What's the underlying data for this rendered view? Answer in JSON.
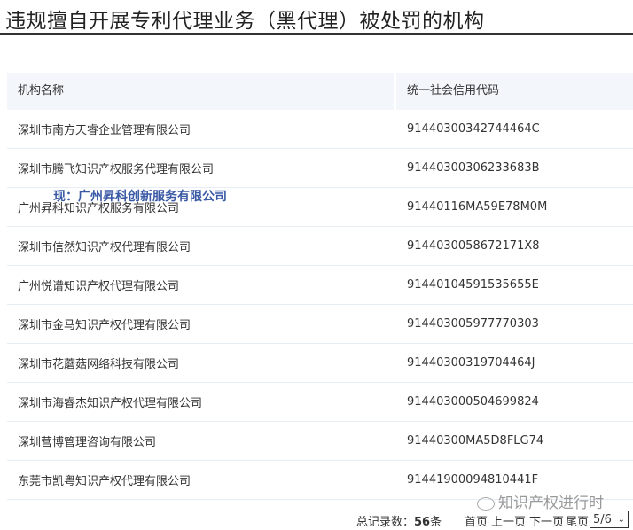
{
  "title": "违规擅自开展专利代理业务（黑代理）被处罚的机构",
  "table": {
    "headers": [
      "机构名称",
      "统一社会信用代码"
    ],
    "rows": [
      {
        "name": "深圳市南方天睿企业管理有限公司",
        "code": "91440300342744464C"
      },
      {
        "name": "深圳市腾飞知识产权服务代理有限公司",
        "code": "91440300306233683B"
      },
      {
        "name": "广州昇科知识产权服务有限公司",
        "code": "91440116MA59E78M0M"
      },
      {
        "name": "深圳市信然知识产权代理有限公司",
        "code": "9144030058672171X8"
      },
      {
        "name": "广州悦谱知识产权代理有限公司",
        "code": "91440104591535655E"
      },
      {
        "name": "深圳市金马知识产权代理有限公司",
        "code": "914403005977770303"
      },
      {
        "name": "深圳市花蘑菇网络科技有限公司",
        "code": "91440300319704464J"
      },
      {
        "name": "深圳市海睿杰知识产权代理有限公司",
        "code": "914403000504699824"
      },
      {
        "name": "深圳营博管理咨询有限公司",
        "code": "91440300MA5D8FLG74"
      },
      {
        "name": "东莞市凯粤知识产权代理有限公司",
        "code": "91441900094810441F"
      }
    ]
  },
  "annotation": "现：广州昇科创新服务有限公司",
  "footer": {
    "total_label": "总记录数：",
    "total_count": "56",
    "total_unit": "条",
    "first": "首页",
    "prev": "上一页",
    "next": "下一页",
    "last": "尾页",
    "page_select": "5/6"
  },
  "watermark": "知识产权进行时"
}
